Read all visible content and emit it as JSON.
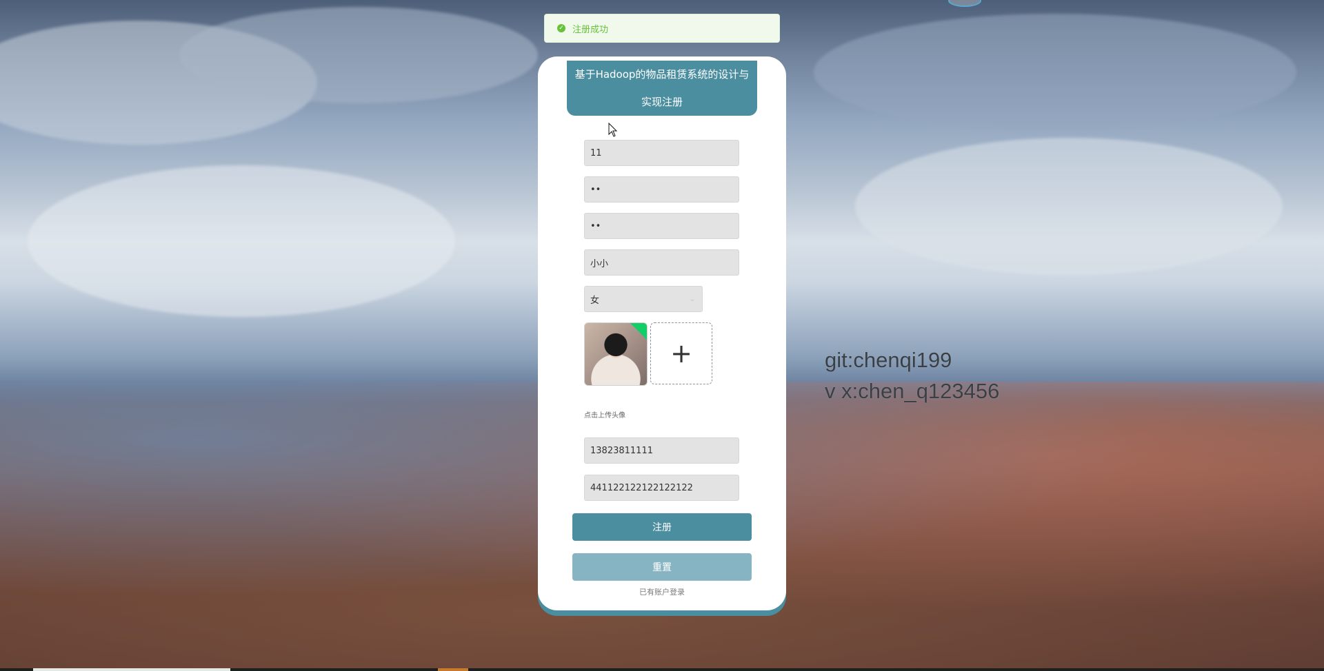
{
  "toast": {
    "icon": "success-check-icon",
    "message": "注册成功",
    "color": "#67c23a"
  },
  "watermark": {
    "line1": "git:chenqi199",
    "line2": "v x:chen_q123456"
  },
  "form": {
    "title_line1": "基于Hadoop的物品租赁系统的设计与",
    "title_line2": "实现注册",
    "account_value": "11",
    "password_value": "••",
    "confirm_password_value": "••",
    "name_value": "小小",
    "gender_value": "女",
    "upload_hint": "点击上传头像",
    "phone_value": "13823811111",
    "id_card_value": "441122122122122122",
    "register_button": "注册",
    "reset_button": "重置",
    "login_link": "已有账户登录",
    "accent_color": "#4b8ea0"
  }
}
